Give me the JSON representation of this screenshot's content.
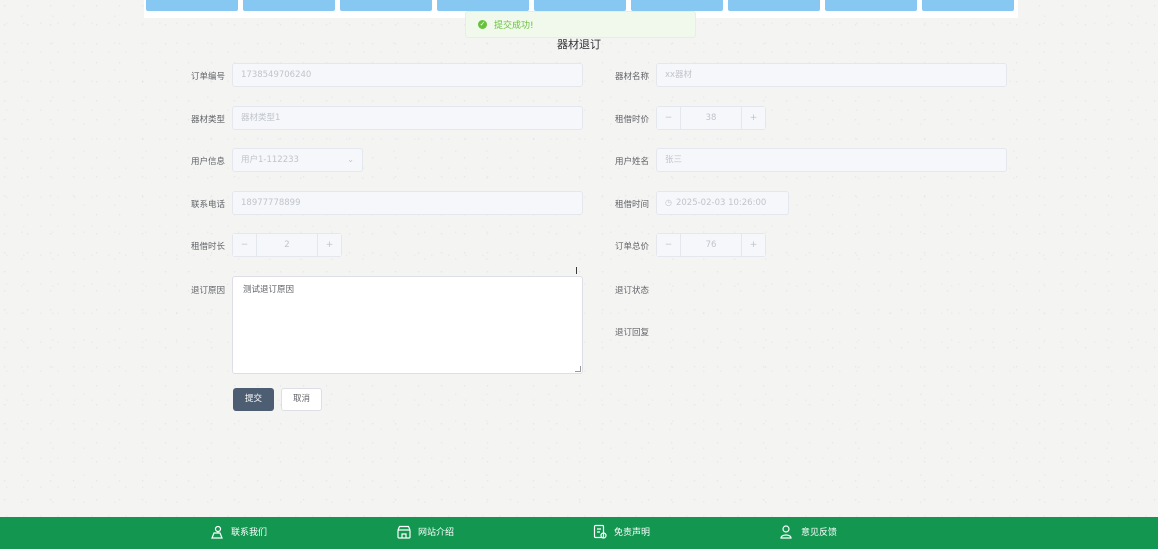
{
  "nav": {
    "tabs": [
      "",
      "",
      "",
      "",
      "",
      "",
      "",
      "",
      ""
    ]
  },
  "toast": {
    "icon": "check-circle-icon",
    "message": "提交成功!"
  },
  "page_title": "器材退订",
  "form": {
    "order_no": {
      "label": "订单编号",
      "value": "1738549706240"
    },
    "equipment_name": {
      "label": "器材名称",
      "value": "xx器材"
    },
    "equipment_type": {
      "label": "器材类型",
      "value": "器材类型1"
    },
    "rental_price": {
      "label": "租借时价",
      "value": "38",
      "minus": "−",
      "plus": "+"
    },
    "user_info": {
      "label": "用户信息",
      "value": "用户1-112233",
      "icon": "chevron-down-icon"
    },
    "user_name": {
      "label": "用户姓名",
      "value": "张三"
    },
    "phone": {
      "label": "联系电话",
      "value": "18977778899"
    },
    "rental_time": {
      "label": "租借时间",
      "value": "2025-02-03 10:26:00",
      "icon": "clock-icon"
    },
    "rental_duration": {
      "label": "租借时长",
      "value": "2",
      "minus": "−",
      "plus": "+"
    },
    "total_price": {
      "label": "订单总价",
      "value": "76",
      "minus": "−",
      "plus": "+"
    },
    "cancel_reason": {
      "label": "退订原因",
      "value": "测试退订原因"
    },
    "cancel_status": {
      "label": "退订状态"
    },
    "cancel_reply": {
      "label": "退订回复"
    }
  },
  "actions": {
    "submit": "提交",
    "cancel": "取消"
  },
  "footer": {
    "items": [
      {
        "label": "联系我们",
        "icon": "contact-icon"
      },
      {
        "label": "网站介绍",
        "icon": "store-icon"
      },
      {
        "label": "免责声明",
        "icon": "document-icon"
      },
      {
        "label": "意见反馈",
        "icon": "user-feedback-icon"
      }
    ]
  },
  "colors": {
    "footer_bg": "#129650",
    "nav_tab": "#86c8f2",
    "submit_bg": "#4d5e72",
    "toast_text": "#67c23a"
  }
}
